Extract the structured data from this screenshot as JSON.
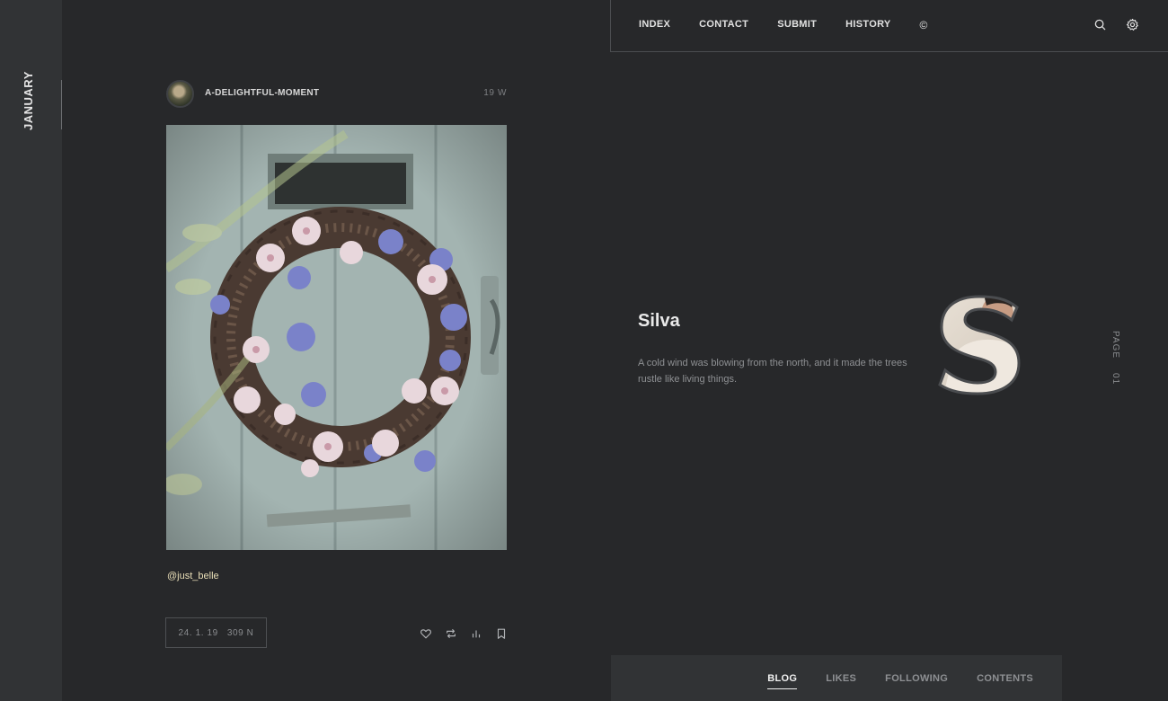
{
  "sidebar": {
    "month": "JANUARY"
  },
  "nav": {
    "links": [
      "INDEX",
      "CONTACT",
      "SUBMIT",
      "HISTORY",
      "©"
    ],
    "search_icon": "search-icon",
    "settings_icon": "gear-icon"
  },
  "post": {
    "username": "A-DELIGHTFUL-MOMENT",
    "age": "19 W",
    "credit": "@just_belle",
    "date": "24. 1. 19",
    "notes": "309 N",
    "actions": [
      "heart-icon",
      "reblog-icon",
      "stats-icon",
      "bookmark-icon"
    ]
  },
  "blog": {
    "title": "Silva",
    "description": "A cold wind was blowing from the north, and it made the trees rustle like living things.",
    "page_label": "PAGE",
    "page_number": "01"
  },
  "tabs": {
    "items": [
      "BLOG",
      "LIKES",
      "FOLLOWING",
      "CONTENTS"
    ],
    "active": "BLOG"
  }
}
